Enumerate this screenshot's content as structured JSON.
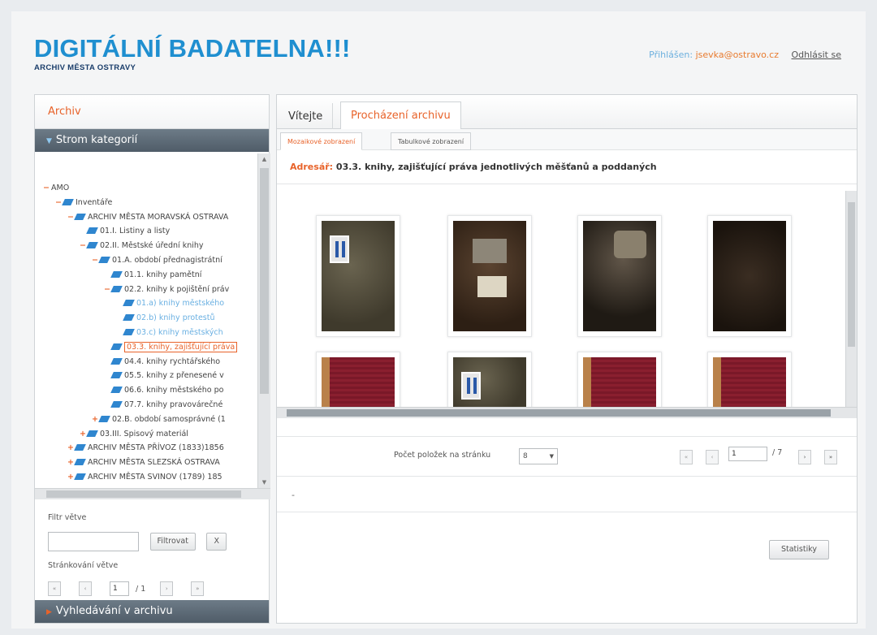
{
  "header": {
    "title": "DIGITÁLNÍ BADATELNA!!!",
    "subtitle": "ARCHIV MĚSTA OSTRAVY",
    "logged_label": "Přihlášen:",
    "user_email": "jsevka@ostravo.cz",
    "logout_label": "Odhlásit se"
  },
  "sidebar": {
    "panel_title": "Archiv",
    "tree_header": "Strom kategorií",
    "search_header": "Vyhledávání v archivu",
    "tree": [
      {
        "toggle": "−",
        "folder": false,
        "text": "AMO",
        "indent": 0,
        "style": ""
      },
      {
        "toggle": "−",
        "folder": true,
        "text": "Inventáře",
        "indent": 1,
        "style": ""
      },
      {
        "toggle": "−",
        "folder": true,
        "text": "ARCHIV MĚSTA MORAVSKÁ OSTRAVA",
        "indent": 2,
        "style": ""
      },
      {
        "toggle": "",
        "folder": true,
        "text": "01.I. Listiny a listy",
        "indent": 3,
        "style": ""
      },
      {
        "toggle": "−",
        "folder": true,
        "text": "02.II. Městské úřední knihy",
        "indent": 3,
        "style": ""
      },
      {
        "toggle": "−",
        "folder": true,
        "text": "01.A. období přednagistrátní",
        "indent": 4,
        "style": ""
      },
      {
        "toggle": "",
        "folder": true,
        "text": "01.1. knihy pamětní",
        "indent": 5,
        "style": ""
      },
      {
        "toggle": "−",
        "folder": true,
        "text": "02.2. knihy k pojištění práv",
        "indent": 5,
        "style": ""
      },
      {
        "toggle": "",
        "folder": true,
        "text": "01.a) knihy městského",
        "indent": 6,
        "style": "sub"
      },
      {
        "toggle": "",
        "folder": true,
        "text": "02.b) knihy protestů",
        "indent": 6,
        "style": "sub"
      },
      {
        "toggle": "",
        "folder": true,
        "text": "03.c) knihy městských",
        "indent": 6,
        "style": "sub"
      },
      {
        "toggle": "",
        "folder": true,
        "text": "03.3. knihy, zajišťující práva",
        "indent": 5,
        "style": "sel"
      },
      {
        "toggle": "",
        "folder": true,
        "text": "04.4. knihy rychtářského",
        "indent": 5,
        "style": ""
      },
      {
        "toggle": "",
        "folder": true,
        "text": "05.5. knihy z přenesené v",
        "indent": 5,
        "style": ""
      },
      {
        "toggle": "",
        "folder": true,
        "text": "06.6. knihy městského po",
        "indent": 5,
        "style": ""
      },
      {
        "toggle": "",
        "folder": true,
        "text": "07.7. knihy pravovárečné",
        "indent": 5,
        "style": ""
      },
      {
        "toggle": "+",
        "folder": true,
        "text": "02.B. období samosprávné (1",
        "indent": 4,
        "style": ""
      },
      {
        "toggle": "+",
        "folder": true,
        "text": "03.III. Spisový materiál",
        "indent": 3,
        "style": ""
      },
      {
        "toggle": "+",
        "folder": true,
        "text": "ARCHIV MĚSTA PŘÍVOZ (1833)1856",
        "indent": 2,
        "style": ""
      },
      {
        "toggle": "+",
        "folder": true,
        "text": "ARCHIV MĚSTA SLEZSKÁ OSTRAVA",
        "indent": 2,
        "style": ""
      },
      {
        "toggle": "+",
        "folder": true,
        "text": "ARCHIV MĚSTA SVINOV (1789) 185",
        "indent": 2,
        "style": ""
      }
    ],
    "filter_label": "Filtr větve",
    "filter_button": "Filtrovat",
    "clear_button": "X",
    "paging_label": "Stránkování větve",
    "page_current": "1",
    "page_total": "/ 1"
  },
  "main": {
    "tabs": [
      "Vítejte",
      "Procházení archivu"
    ],
    "subtabs": [
      "Mozaikové zobrazení",
      "Tabulkové zobrazení"
    ],
    "address_key": "Adresář:",
    "address_value": "03.3. knihy, zajišťující práva jednotlivých měšťanů a poddaných",
    "items_per_page_label": "Počet položek na stránku",
    "items_per_page_value": "8",
    "page_current": "1",
    "page_total": "/ 7",
    "dash": "-",
    "stats_button": "Statistiky"
  },
  "colors": {
    "brand_blue": "#1f8fd0",
    "accent_orange": "#e8632a",
    "header_bar": "#56636e"
  },
  "thumbnails": [
    {
      "name": "book-1",
      "style": "grey-label"
    },
    {
      "name": "book-2",
      "style": "brown-labels"
    },
    {
      "name": "book-3",
      "style": "dark-patch"
    },
    {
      "name": "book-4",
      "style": "dark"
    },
    {
      "name": "book-5",
      "style": "red"
    },
    {
      "name": "book-6",
      "style": "grey-label"
    },
    {
      "name": "book-7",
      "style": "red"
    },
    {
      "name": "book-8",
      "style": "red"
    }
  ]
}
